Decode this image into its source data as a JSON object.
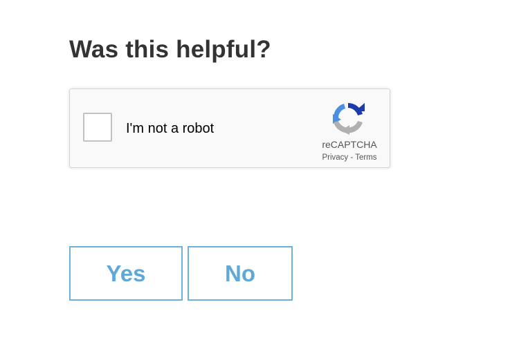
{
  "heading": "Was this helpful?",
  "recaptcha": {
    "checkbox_label": "I'm not a robot",
    "brand": "reCAPTCHA",
    "privacy_link": "Privacy",
    "separator": " - ",
    "terms_link": "Terms",
    "checked": false,
    "colors": {
      "logo_blue_dark": "#1c3aa9",
      "logo_blue_light": "#4a90e2",
      "logo_gray": "#b0b0b0"
    }
  },
  "vote": {
    "yes_label": "Yes",
    "no_label": "No",
    "accent_color": "#5fa8d8"
  }
}
